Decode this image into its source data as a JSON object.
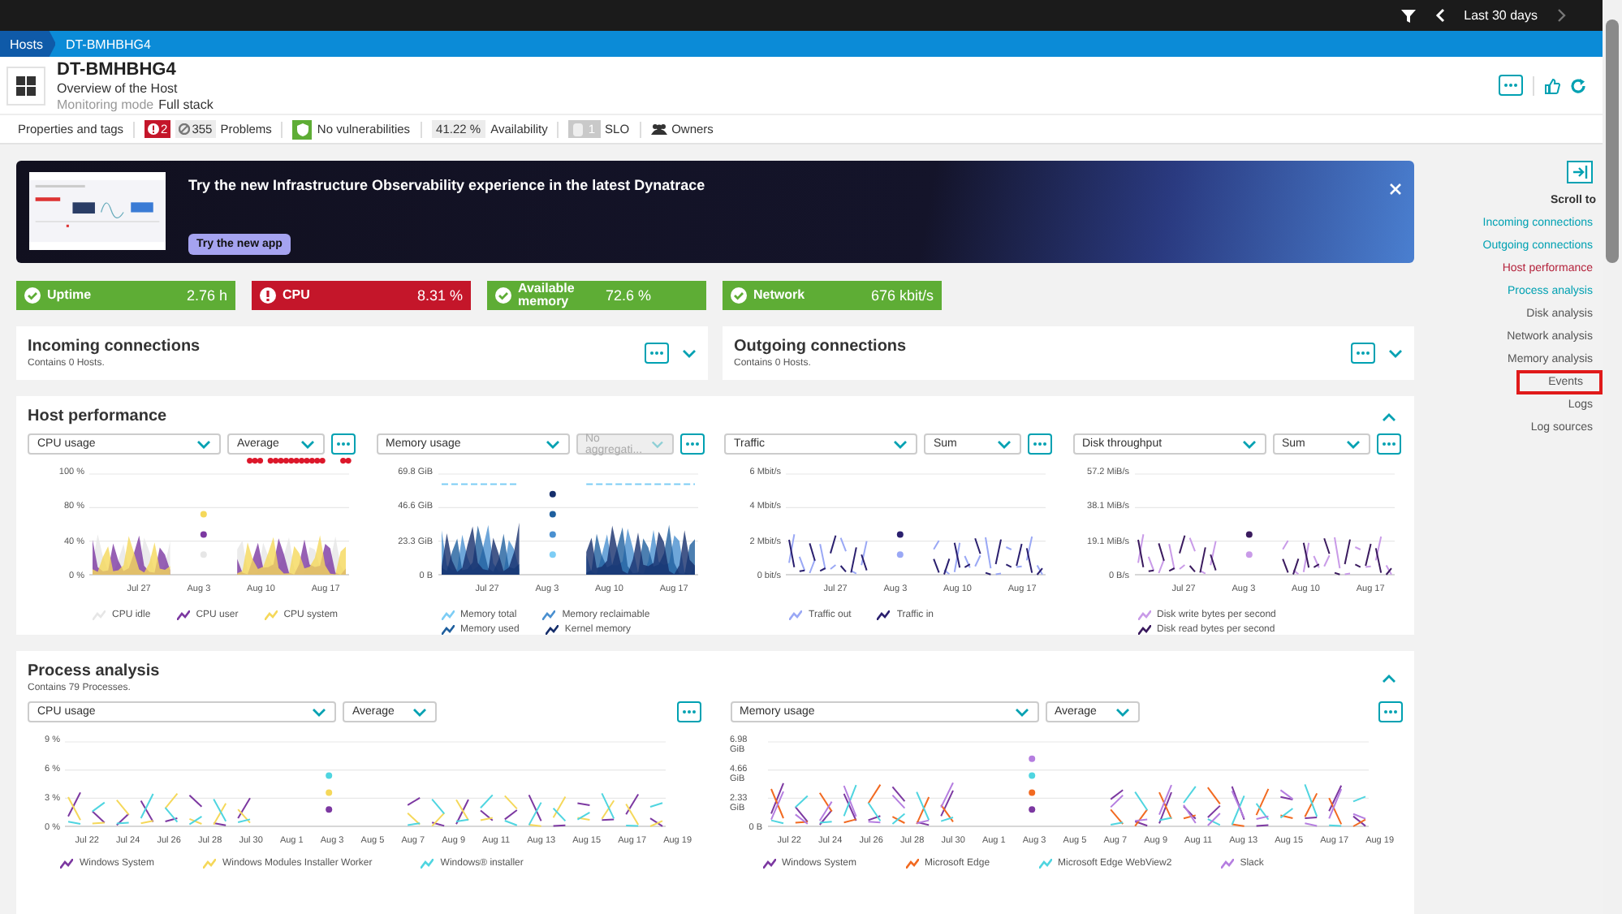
{
  "top_bar": {
    "time_range": "Last 30 days"
  },
  "breadcrumb": [
    "Hosts",
    "DT-BMHBHG4"
  ],
  "host": {
    "name": "DT-BMHBHG4",
    "subtitle": "Overview of the Host",
    "monitoring_label": "Monitoring mode",
    "monitoring_value": "Full stack"
  },
  "info_bar": {
    "properties": "Properties and tags",
    "problems_open": "2",
    "problems_closed": "355",
    "problems_label": "Problems",
    "vulnerabilities": "No vulnerabilities",
    "availability_value": "41.22 %",
    "availability_label": "Availability",
    "slo_count": "1",
    "slo_label": "SLO",
    "owners": "Owners"
  },
  "banner": {
    "title": "Try the new Infrastructure Observability experience in the latest Dynatrace",
    "button": "Try the new app"
  },
  "tiles": [
    {
      "label": "Uptime",
      "value": "2.76 h",
      "alert": false
    },
    {
      "label": "CPU",
      "value": "8.31 %",
      "alert": true
    },
    {
      "label": "Available memory",
      "value": "72.6 %",
      "alert": false
    },
    {
      "label": "Network",
      "value": "676 kbit/s",
      "alert": false
    }
  ],
  "connections": [
    {
      "title": "Incoming connections",
      "subtitle": "Contains 0 Hosts.",
      "expanded": false
    },
    {
      "title": "Outgoing connections",
      "subtitle": "Contains 0 Hosts.",
      "expanded": false
    }
  ],
  "host_performance": {
    "title": "Host performance",
    "expanded": true,
    "charts": [
      {
        "metric": "CPU usage",
        "aggregation": "Average",
        "aggregation_disabled": false,
        "kind": "area",
        "event_markers": true,
        "yticks": [
          "100 %",
          "80 %",
          "40 %",
          "0 %"
        ],
        "xticks": [
          "Jul 27",
          "Aug 3",
          "Aug 10",
          "Aug 17"
        ],
        "legend": [
          {
            "label": "CPU idle",
            "color": "#e6e6e6"
          },
          {
            "label": "CPU user",
            "color": "#7c38a1"
          },
          {
            "label": "CPU system",
            "color": "#f5d85a"
          }
        ]
      },
      {
        "metric": "Memory usage",
        "aggregation": "No aggregati...",
        "aggregation_disabled": true,
        "kind": "area",
        "yticks": [
          "69.8 GiB",
          "46.6 GiB",
          "23.3 GiB",
          "0 B"
        ],
        "xticks": [
          "Jul 27",
          "Aug 3",
          "Aug 10",
          "Aug 17"
        ],
        "legend": [
          {
            "label": "Memory total",
            "color": "#7dcdf5"
          },
          {
            "label": "Memory reclaimable",
            "color": "#4a90d0"
          },
          {
            "label": "Memory used",
            "color": "#1f5f9e"
          },
          {
            "label": "Kernel memory",
            "color": "#152e6b"
          }
        ]
      },
      {
        "metric": "Traffic",
        "aggregation": "Sum",
        "aggregation_disabled": false,
        "kind": "line",
        "yticks": [
          "6 Mbit/s",
          "4 Mbit/s",
          "2 Mbit/s",
          "0 bit/s"
        ],
        "xticks": [
          "Jul 27",
          "Aug 3",
          "Aug 10",
          "Aug 17"
        ],
        "legend": [
          {
            "label": "Traffic out",
            "color": "#9aa8f5"
          },
          {
            "label": "Traffic in",
            "color": "#2a1f6e"
          }
        ]
      },
      {
        "metric": "Disk throughput",
        "aggregation": "Sum",
        "aggregation_disabled": false,
        "kind": "line",
        "yticks": [
          "57.2 MiB/s",
          "38.1 MiB/s",
          "19.1 MiB/s",
          "0 B/s"
        ],
        "xticks": [
          "Jul 27",
          "Aug 3",
          "Aug 10",
          "Aug 17"
        ],
        "legend": [
          {
            "label": "Disk write bytes per second",
            "color": "#c99be8"
          },
          {
            "label": "Disk read bytes per second",
            "color": "#3a1a5e"
          }
        ]
      }
    ]
  },
  "process_analysis": {
    "title": "Process analysis",
    "subtitle": "Contains 79 Processes.",
    "expanded": true,
    "charts": [
      {
        "metric": "CPU usage",
        "aggregation": "Average",
        "aggregation_disabled": false,
        "kind": "line",
        "yticks": [
          "9 %",
          "6 %",
          "3 %",
          "0 %"
        ],
        "xticks": [
          "Jul 22",
          "Jul 24",
          "Jul 26",
          "Jul 28",
          "Jul 30",
          "Aug 1",
          "Aug 3",
          "Aug 5",
          "Aug 7",
          "Aug 9",
          "Aug 11",
          "Aug 13",
          "Aug 15",
          "Aug 17",
          "Aug 19"
        ],
        "legend": [
          {
            "label": "Windows System",
            "color": "#7c38a1"
          },
          {
            "label": "Windows Modules Installer Worker",
            "color": "#f5d85a"
          },
          {
            "label": "Windows® installer",
            "color": "#4fd5e0"
          }
        ]
      },
      {
        "metric": "Memory usage",
        "aggregation": "Average",
        "aggregation_disabled": false,
        "kind": "line",
        "yticks": [
          "6.98 GiB",
          "4.66 GiB",
          "2.33 GiB",
          "0 B"
        ],
        "xticks": [
          "Jul 22",
          "Jul 24",
          "Jul 26",
          "Jul 28",
          "Jul 30",
          "Aug 1",
          "Aug 3",
          "Aug 5",
          "Aug 7",
          "Aug 9",
          "Aug 11",
          "Aug 13",
          "Aug 15",
          "Aug 17",
          "Aug 19"
        ],
        "legend": [
          {
            "label": "Windows System",
            "color": "#7c38a1"
          },
          {
            "label": "Microsoft Edge",
            "color": "#f26a21"
          },
          {
            "label": "Microsoft Edge WebView2",
            "color": "#4fd5e0"
          },
          {
            "label": "Slack",
            "color": "#b57ee0"
          }
        ]
      }
    ]
  },
  "sidebar": {
    "heading": "Scroll to",
    "items": [
      {
        "label": "Incoming connections",
        "selected": false,
        "available": true,
        "highlighted": false
      },
      {
        "label": "Outgoing connections",
        "selected": false,
        "available": true,
        "highlighted": false
      },
      {
        "label": "Host performance",
        "selected": true,
        "available": true,
        "highlighted": false
      },
      {
        "label": "Process analysis",
        "selected": false,
        "available": true,
        "highlighted": false
      },
      {
        "label": "Disk analysis",
        "selected": false,
        "available": false,
        "highlighted": false
      },
      {
        "label": "Network analysis",
        "selected": false,
        "available": false,
        "highlighted": false
      },
      {
        "label": "Memory analysis",
        "selected": false,
        "available": false,
        "highlighted": false
      },
      {
        "label": "Events",
        "selected": false,
        "available": false,
        "highlighted": true
      },
      {
        "label": "Logs",
        "selected": false,
        "available": false,
        "highlighted": false
      },
      {
        "label": "Log sources",
        "selected": false,
        "available": false,
        "highlighted": false
      }
    ]
  }
}
